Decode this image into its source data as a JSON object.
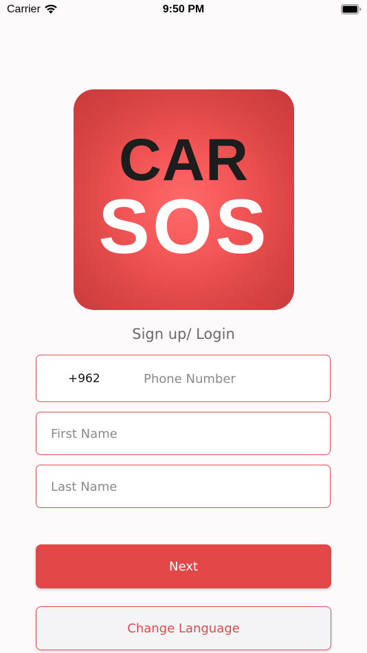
{
  "status_bar": {
    "carrier": "Carrier",
    "time": "9:50 PM",
    "wifi_icon": "wifi-icon",
    "battery_icon": "battery-full-icon"
  },
  "logo": {
    "line1": "CAR",
    "line2": "SOS",
    "background_color": "#e04a4a",
    "line1_color": "#1d1d1d",
    "line2_color": "#ffffff"
  },
  "heading": "Sign up/ Login",
  "form": {
    "country_code": "+962",
    "phone_placeholder": "Phone Number",
    "first_name_placeholder": "First Name",
    "last_name_placeholder": "Last Name"
  },
  "buttons": {
    "next_label": "Next",
    "change_language_label": "Change Language"
  },
  "colors": {
    "accent": "#e14848",
    "border": "#e05252",
    "background": "#fdfafc"
  }
}
